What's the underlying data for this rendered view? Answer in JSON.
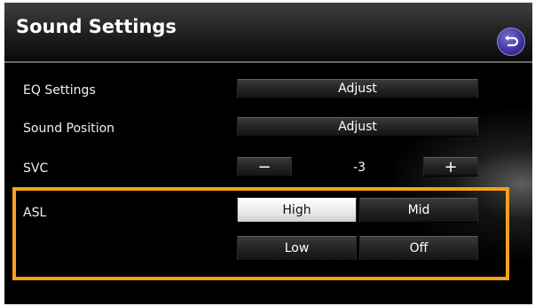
{
  "header": {
    "title": "Sound Settings",
    "back_icon": "return-arrow-icon"
  },
  "rows": {
    "eq": {
      "label": "EQ Settings",
      "button": "Adjust"
    },
    "position": {
      "label": "Sound Position",
      "button": "Adjust"
    },
    "svc": {
      "label": "SVC",
      "minus": "−",
      "value": "-3",
      "plus": "+"
    },
    "asl": {
      "label": "ASL",
      "options": [
        "High",
        "Mid",
        "Low",
        "Off"
      ],
      "selected": "High"
    }
  },
  "colors": {
    "highlight": "#f5a21b",
    "back_button": "#3c32a0"
  }
}
